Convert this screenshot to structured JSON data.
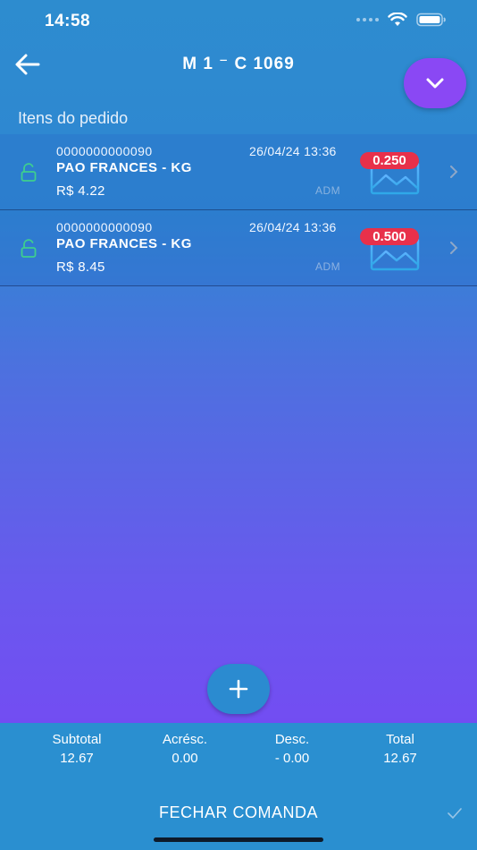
{
  "status_bar": {
    "time": "14:58"
  },
  "header": {
    "title": "M 1 ⁻ C 1069"
  },
  "section_title": "Itens do pedido",
  "items": [
    {
      "code": "0000000000090",
      "date": "26/04/24 13:36",
      "name": "PAO FRANCES - KG",
      "price": "R$ 4.22",
      "user": "ADM",
      "quantity": "0.250"
    },
    {
      "code": "0000000000090",
      "date": "26/04/24 13:36",
      "name": "PAO FRANCES - KG",
      "price": "R$ 8.45",
      "user": "ADM",
      "quantity": "0.500"
    }
  ],
  "totals": {
    "subtotal": {
      "label": "Subtotal",
      "value": "12.67"
    },
    "acrescimo": {
      "label": "Acrésc.",
      "value": "0.00"
    },
    "desconto": {
      "label": "Desc.",
      "value": "- 0.00"
    },
    "total": {
      "label": "Total",
      "value": "12.67"
    }
  },
  "footer": {
    "close_label": "FECHAR COMANDA"
  },
  "colors": {
    "badge": "#e8304a",
    "fab_purple": "#8a48f4",
    "footer": "#2a8fd0",
    "lock_green": "#3ecf8e"
  }
}
